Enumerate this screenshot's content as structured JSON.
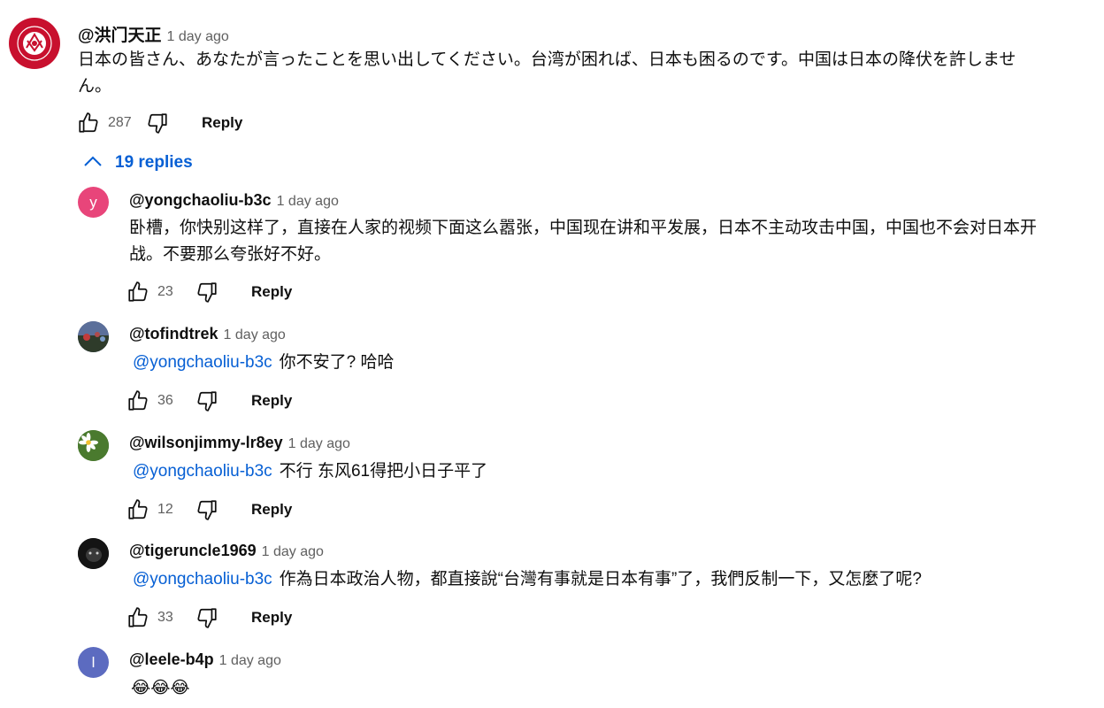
{
  "top_comment": {
    "author": "@洪门天正",
    "timestamp": "1 day ago",
    "text_line1": "日本の皆さん、あなたが言ったことを思い出してください。台湾が困れば、日本も困るのです。中国は日本の降伏を許しませ",
    "text_line2": "ん。",
    "likes": "287",
    "reply_label": "Reply"
  },
  "replies_toggle": {
    "label": "19 replies"
  },
  "replies": [
    {
      "author": "@yongchaoliu-b3c",
      "avatar_letter": "y",
      "avatar_color": "#e8457a",
      "timestamp": "1 day ago",
      "text_line1": "卧槽，你快别这样了，直接在人家的视频下面这么嚣张，中国现在讲和平发展，日本不主动攻击中国，中国也不会对日本开",
      "text_line2": "战。不要那么夸张好不好。",
      "likes": "23",
      "reply_label": "Reply"
    },
    {
      "author": "@tofindtrek",
      "timestamp": "1 day ago",
      "mention": "@yongchaoliu-b3c",
      "text": "你不安了? 哈哈",
      "likes": "36",
      "reply_label": "Reply"
    },
    {
      "author": "@wilsonjimmy-lr8ey",
      "timestamp": "1 day ago",
      "mention": "@yongchaoliu-b3c",
      "text": "不行 东风61得把小日子平了",
      "likes": "12",
      "reply_label": "Reply"
    },
    {
      "author": "@tigeruncle1969",
      "timestamp": "1 day ago",
      "mention": "@yongchaoliu-b3c",
      "text": "作為日本政治人物，都直接說“台灣有事就是日本有事”了，我們反制一下，又怎麼了呢?",
      "likes": "33",
      "reply_label": "Reply"
    },
    {
      "author": "@leele-b4p",
      "avatar_letter": "l",
      "avatar_color": "#5c6bc0",
      "timestamp": "1 day ago",
      "text": "😂😂😂"
    }
  ]
}
